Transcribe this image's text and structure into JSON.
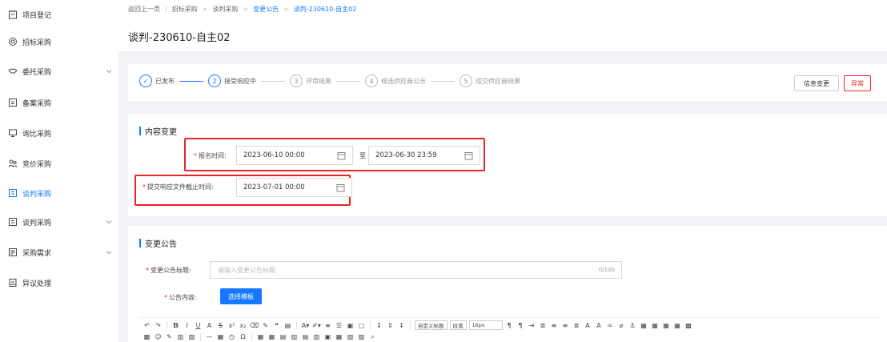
{
  "sidebar": {
    "items": [
      {
        "label": "项目登记",
        "icon": "calendar-icon"
      },
      {
        "label": "招标采购",
        "icon": "target-icon"
      },
      {
        "label": "委托采购",
        "icon": "handshake-icon"
      },
      {
        "label": "备案采购",
        "icon": "archive-icon"
      },
      {
        "label": "询比采购",
        "icon": "monitor-icon"
      },
      {
        "label": "竞价采购",
        "icon": "users-icon"
      },
      {
        "label": "谈判采购",
        "icon": "document-icon"
      },
      {
        "label": "谈判采购",
        "icon": "document-icon"
      },
      {
        "label": "采购需求",
        "icon": "list-icon"
      },
      {
        "label": "异议处理",
        "icon": "file-icon"
      }
    ]
  },
  "breadcrumb": {
    "back": "返回上一页",
    "items": [
      "招标采购",
      "谈判采购",
      "变更公告",
      "谈判-230610-自主02"
    ]
  },
  "page": {
    "title": "谈判-230610-自主02"
  },
  "steps": [
    {
      "num": "✓",
      "label": "已发布"
    },
    {
      "num": "2",
      "label": "接受响应中"
    },
    {
      "num": "3",
      "label": "评审结果"
    },
    {
      "num": "4",
      "label": "候选供应商公示"
    },
    {
      "num": "5",
      "label": "成交供应商结果"
    }
  ],
  "actions": {
    "change": "信息变更",
    "abnormal": "异常"
  },
  "content_change": {
    "title": "内容变更",
    "signup_label": "报名时间:",
    "signup_start": "2023-06-10 00:00",
    "range_sep": "至",
    "signup_end": "2023-06-30 23:59",
    "deadline_label": "提交响应文件截止时间:",
    "deadline_value": "2023-07-01 00:00"
  },
  "notice": {
    "title": "变更公告",
    "title_label": "变更公告标题:",
    "title_placeholder": "请输入变更公告标题",
    "title_count": "0/100",
    "content_label": "公告内容:",
    "template_button": "选择模板"
  },
  "editor": {
    "custom_heading": "自定义标题",
    "paragraph": "段落",
    "font_size": "16px"
  },
  "colors": {
    "accent": "#1677ff",
    "danger": "#f5222d",
    "highlight_box": "#e82424"
  }
}
